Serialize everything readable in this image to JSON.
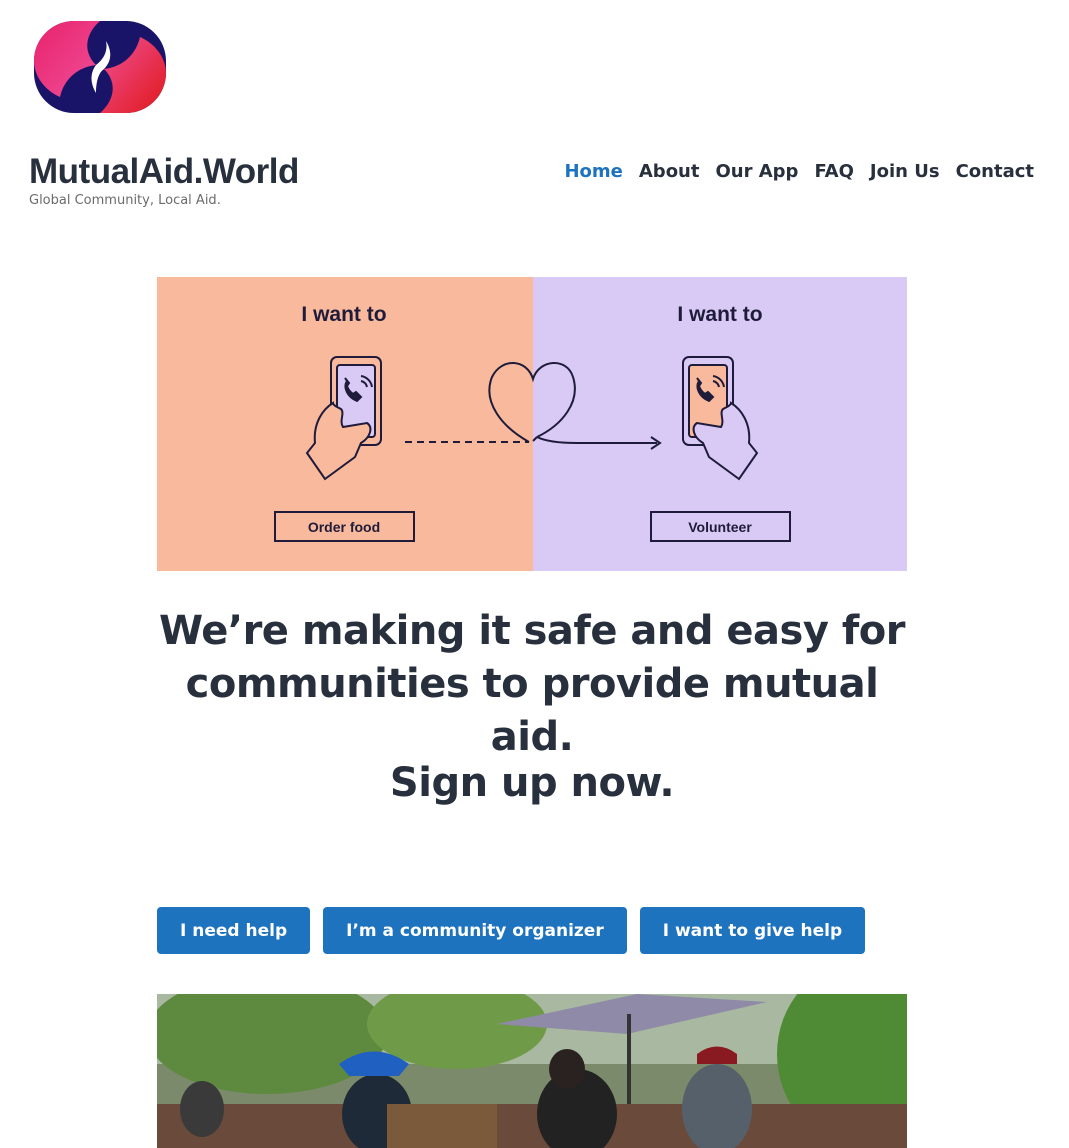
{
  "site": {
    "title": "MutualAid.World",
    "tagline": "Global Community, Local Aid."
  },
  "nav": {
    "items": [
      "Home",
      "About",
      "Our App",
      "FAQ",
      "Join Us",
      "Contact"
    ],
    "active": "Home"
  },
  "hero": {
    "left_heading": "I want to",
    "left_label": "Order food",
    "right_heading": "I want to",
    "right_label": "Volunteer",
    "left_color": "#f8b99c",
    "right_color": "#d9c9f5"
  },
  "main": {
    "headline": "We’re making it safe and easy for communities to provide mutual aid.",
    "signup": "Sign up now."
  },
  "buttons": {
    "need_help": "I need help",
    "organizer": "I’m a community organizer",
    "give_help": "I want to give help"
  },
  "colors": {
    "accent": "#1e73be",
    "text": "#28303d"
  }
}
